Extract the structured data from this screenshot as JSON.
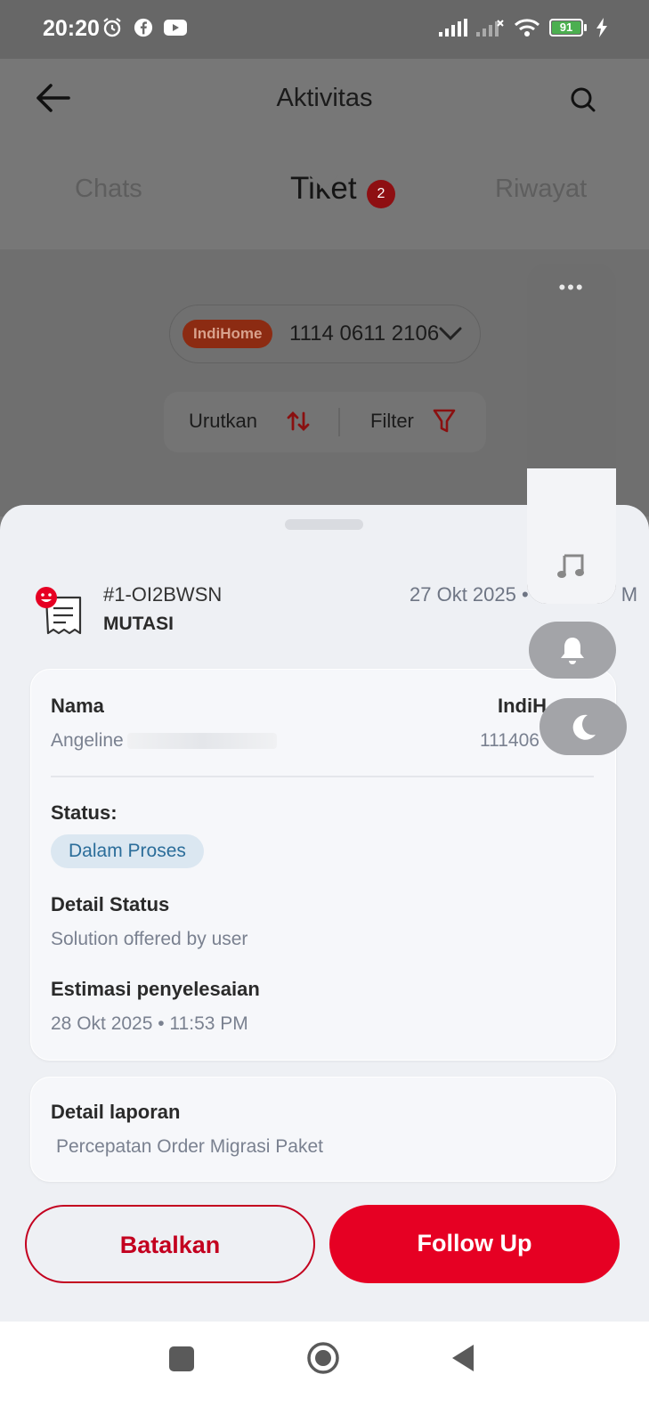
{
  "status_bar": {
    "time": "20:20",
    "battery": "91",
    "left_icons": [
      "alarm-icon",
      "facebook-icon",
      "youtube-icon"
    ],
    "right_icons": [
      "signal-icon",
      "signal-no-service-icon",
      "wifi-icon",
      "battery-icon",
      "charging-icon"
    ]
  },
  "header": {
    "title": "Aktivitas",
    "tabs": [
      {
        "label": "Chats",
        "active": false
      },
      {
        "label": "Tiket",
        "active": true,
        "badge": "2"
      },
      {
        "label": "Riwayat",
        "active": false
      }
    ]
  },
  "background": {
    "account_chip": "IndiHome",
    "account_number": "1114 0611 2106",
    "sort_label": "Urutkan",
    "filter_label": "Filter"
  },
  "ticket": {
    "id": "#1-OI2BWSN",
    "type": "MUTASI",
    "date": "27 Okt 2025 • ",
    "date_tail": "M",
    "name_label": "Nama",
    "name_value": "Angeline",
    "product_label": "IndiH",
    "product_value": "111406",
    "status_label": "Status:",
    "status_value": "Dalam Proses",
    "detail_status_label": "Detail Status",
    "detail_status_value": "Solution offered by user",
    "estimate_label": "Estimasi penyelesaian",
    "estimate_value": "28 Okt 2025 • 11:53 PM",
    "report_label": "Detail laporan",
    "report_value": "Percepatan Order Migrasi Paket"
  },
  "actions": {
    "cancel_label": "Batalkan",
    "follow_label": "Follow Up"
  },
  "overlay": {
    "dots": "•••"
  },
  "colors": {
    "brand_red": "#e60023",
    "status_blue": "#2b6d9a",
    "status_pill_bg": "#dbe7f1",
    "scrim_gray": "#777777"
  }
}
